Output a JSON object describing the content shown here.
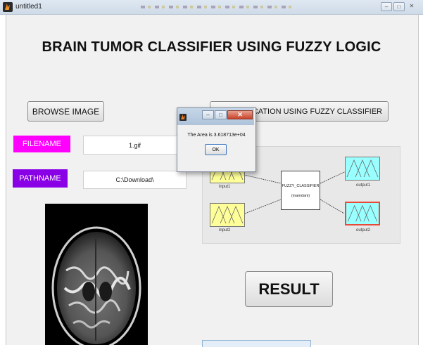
{
  "window": {
    "title": "untitled1"
  },
  "heading": "BRAIN TUMOR CLASSIFIER USING FUZZY LOGIC",
  "buttons": {
    "browse": "BROWSE IMAGE",
    "classify": "CLASSIFICATION USING FUZZY CLASSIFIER",
    "result": "RESULT"
  },
  "fields": {
    "filename_label": "FILENAME",
    "filename_value": "1.gif",
    "pathname_label": "PATHNAME",
    "pathname_value": "C:\\Download\\"
  },
  "fis_diagram": {
    "input1": "input1",
    "input2": "input2",
    "output1": "output1",
    "output2": "output2",
    "system_name": "FUZZY_CLASSIFIER",
    "system_type": "(mamdani)"
  },
  "dialog": {
    "message": "The Area is 3.618713e+04",
    "ok_label": "OK"
  },
  "colors": {
    "filename_label_bg": "#ff00ff",
    "pathname_label_bg": "#8a00e6",
    "input_mf_bg": "#ffff99",
    "output_mf_bg": "#99ffff",
    "selected_border": "#e84a3a"
  },
  "icons": {
    "app": "matlab-icon",
    "minimize": "minimize-icon",
    "maximize": "maximize-icon",
    "close": "close-icon"
  }
}
